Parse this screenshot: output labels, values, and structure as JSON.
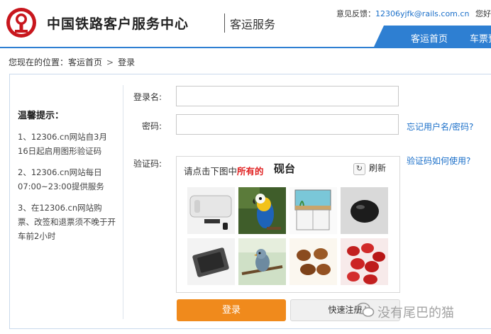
{
  "header": {
    "site_name": "中国铁路客户服务中心",
    "sub_name": "客运服务",
    "feedback_label": "意见反馈：",
    "feedback_email": "12306yjfk@rails.com.cn",
    "greeting": "您好",
    "nav": {
      "home": "客运首页",
      "tickets": "车票预"
    }
  },
  "breadcrumb": {
    "prefix": "您现在的位置：",
    "home": "客运首页",
    "sep": ">",
    "current": "登录"
  },
  "tips": {
    "title": "温馨提示：",
    "items": [
      "1、12306.cn网站自3月16日起启用图形验证码",
      "2、12306.cn网站每日07:00~23:00提供服务",
      "3、在12306.cn网站购票、改签和退票须不晚于开车前2小时"
    ]
  },
  "form": {
    "username_label": "登录名:",
    "username_value": "",
    "password_label": "密码:",
    "password_value": "",
    "forgot_link": "忘记用户名/密码?",
    "captcha_label": "验证码:",
    "captcha_help_link": "验证码如何使用?"
  },
  "captcha": {
    "prompt_prefix": "请点击下图中",
    "prompt_highlight": "所有的",
    "target_word": "砚台",
    "refresh_label": "刷新",
    "refresh_icon": "refresh-icon",
    "tiles": [
      "water-heater",
      "parrot",
      "aquarium",
      "black-stone",
      "ink-stone-tray",
      "bird-on-branch",
      "pastries",
      "red-dates"
    ]
  },
  "buttons": {
    "login": "登录",
    "register": "快速注册"
  },
  "watermark": {
    "text": "没有尾巴的猫",
    "icon": "wechat-icon"
  },
  "colors": {
    "brand_blue": "#2e7fd2",
    "login_orange": "#f08a1c",
    "logo_red": "#c8161d",
    "highlight_red": "#e02020"
  }
}
